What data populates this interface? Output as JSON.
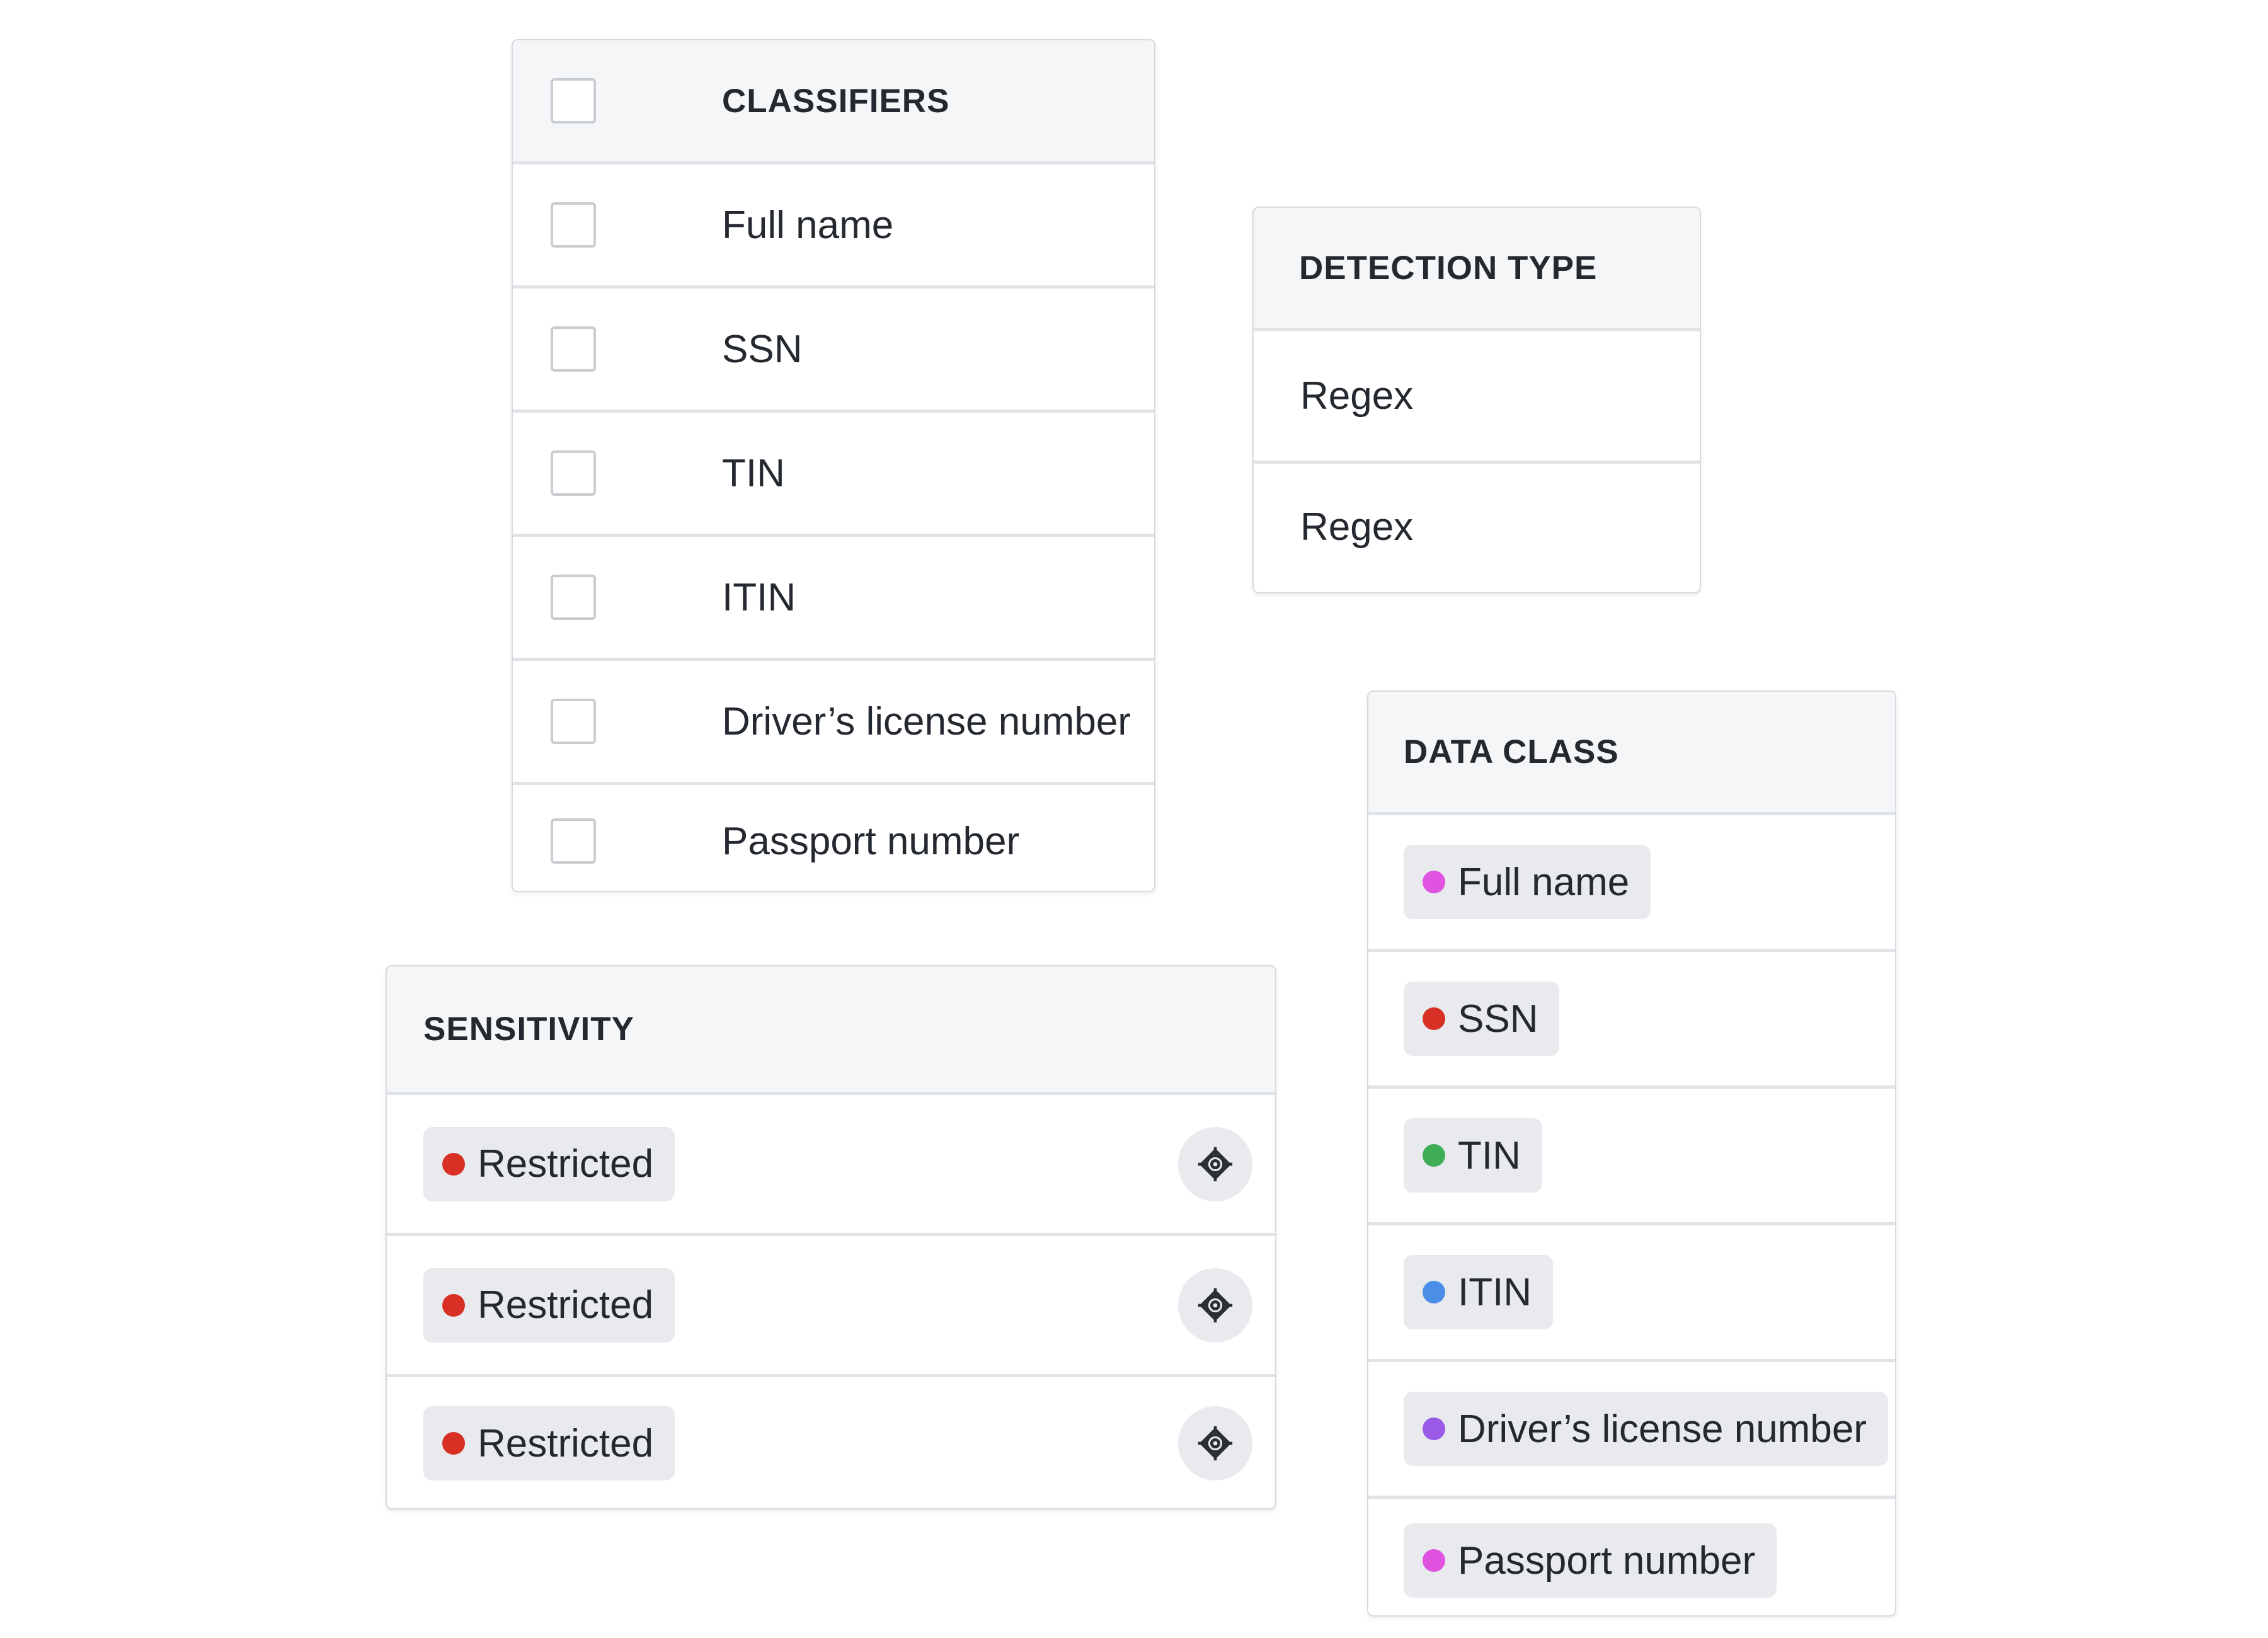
{
  "classifiers": {
    "header": "CLASSIFIERS",
    "rows": [
      {
        "label": "Full name"
      },
      {
        "label": "SSN"
      },
      {
        "label": "TIN"
      },
      {
        "label": "ITIN"
      },
      {
        "label": "Driver’s license number"
      },
      {
        "label": "Passport number"
      }
    ]
  },
  "detection_type": {
    "header": "DETECTION TYPE",
    "rows": [
      {
        "label": "Regex"
      },
      {
        "label": "Regex"
      }
    ]
  },
  "sensitivity": {
    "header": "SENSITIVITY",
    "rows": [
      {
        "label": "Restricted",
        "dot_color": "#d93025",
        "icon": "target-icon"
      },
      {
        "label": "Restricted",
        "dot_color": "#d93025",
        "icon": "target-icon"
      },
      {
        "label": "Restricted",
        "dot_color": "#d93025",
        "icon": "target-icon"
      }
    ]
  },
  "data_class": {
    "header": "DATA CLASS",
    "rows": [
      {
        "label": "Full name",
        "dot_color": "#e052e0"
      },
      {
        "label": "SSN",
        "dot_color": "#d93025"
      },
      {
        "label": "TIN",
        "dot_color": "#3fae56"
      },
      {
        "label": "ITIN",
        "dot_color": "#4a8ee8"
      },
      {
        "label": "Driver’s license number",
        "dot_color": "#9b59e8"
      },
      {
        "label": "Passport number",
        "dot_color": "#e052e0"
      }
    ]
  }
}
